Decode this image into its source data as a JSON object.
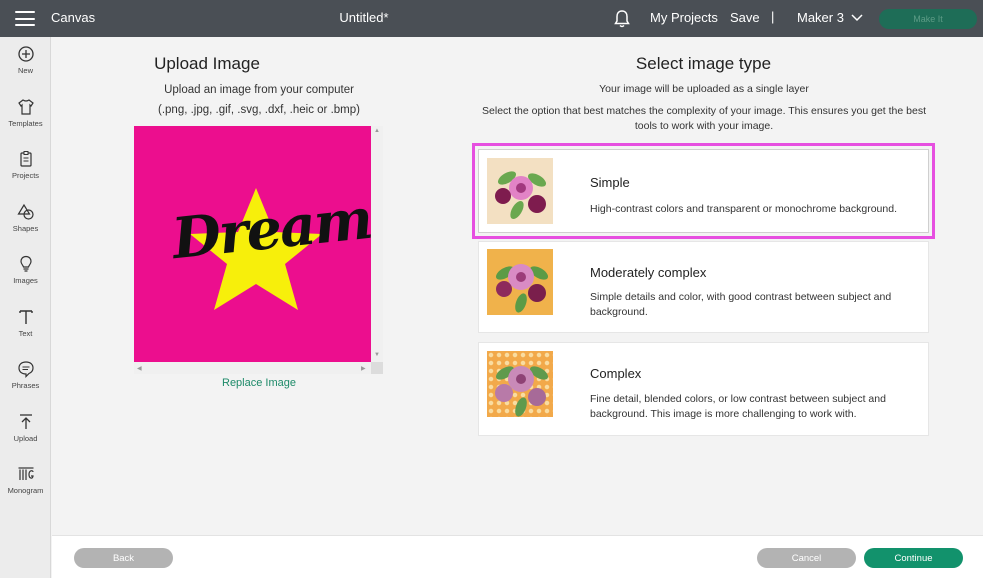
{
  "topbar": {
    "app_title": "Canvas",
    "doc_title": "Untitled*",
    "my_projects": "My Projects",
    "save": "Save",
    "separator": "|",
    "machine": "Maker 3",
    "make_it": "Make It"
  },
  "sidebar": {
    "items": [
      {
        "label": "New",
        "icon": "plus-circle-icon"
      },
      {
        "label": "Templates",
        "icon": "shirt-icon"
      },
      {
        "label": "Projects",
        "icon": "clipboard-icon"
      },
      {
        "label": "Shapes",
        "icon": "shapes-icon"
      },
      {
        "label": "Images",
        "icon": "bulb-icon"
      },
      {
        "label": "Text",
        "icon": "text-icon"
      },
      {
        "label": "Phrases",
        "icon": "speech-bubble-icon"
      },
      {
        "label": "Upload",
        "icon": "upload-icon"
      },
      {
        "label": "Monogram",
        "icon": "monogram-icon"
      }
    ]
  },
  "upload": {
    "title": "Upload Image",
    "subtitle_1": "Upload an image from your computer",
    "subtitle_2": "(.png, .jpg, .gif, .svg, .dxf, .heic or .bmp)",
    "preview_word": "Dream",
    "replace": "Replace Image",
    "colors": {
      "background": "#ec0e8e",
      "star": "#f7ef0b"
    }
  },
  "image_type": {
    "title": "Select image type",
    "sub_1": "Your image will be uploaded as a single layer",
    "sub_2": "Select the option that best matches the complexity of your image. This ensures you get the best tools to work with your image.",
    "options": [
      {
        "title": "Simple",
        "desc": "High-contrast colors and transparent or monochrome background.",
        "selected": true
      },
      {
        "title": "Moderately complex",
        "desc": "Simple details and color, with good contrast between subject and background.",
        "selected": false
      },
      {
        "title": "Complex",
        "desc": "Fine detail, blended colors, or low contrast between subject and background. This image is more challenging to work with.",
        "selected": false
      }
    ]
  },
  "footer": {
    "back": "Back",
    "cancel": "Cancel",
    "continue": "Continue"
  },
  "colors": {
    "accent": "#12926c",
    "selection_outline": "#e64fe0",
    "topbar": "#4a4f55"
  }
}
